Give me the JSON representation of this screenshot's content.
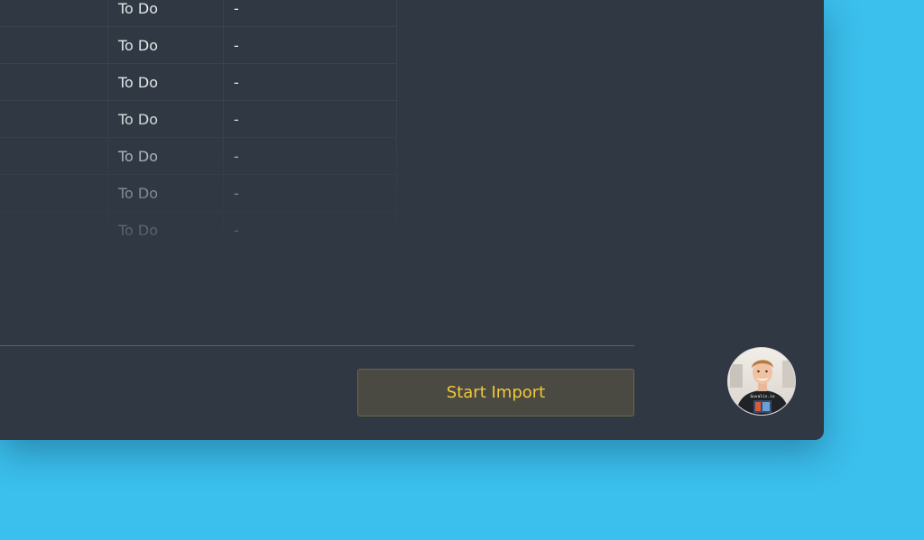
{
  "table": {
    "rows": [
      {
        "status": "To Do",
        "assignee": "-"
      },
      {
        "status": "To Do",
        "assignee": "-"
      },
      {
        "status": "To Do",
        "assignee": "-"
      },
      {
        "status": "To Do",
        "assignee": "-"
      },
      {
        "status": "To Do",
        "assignee": "-"
      },
      {
        "status": "To Do",
        "assignee": "-"
      },
      {
        "status": "To Do",
        "assignee": "-"
      }
    ]
  },
  "footer": {
    "start_import_label": "Start Import"
  },
  "avatar": {
    "shirt_text": "Guvalis.io"
  },
  "colors": {
    "background": "#3bbfec",
    "window": "#2f3843",
    "accent": "#f2c83a"
  }
}
